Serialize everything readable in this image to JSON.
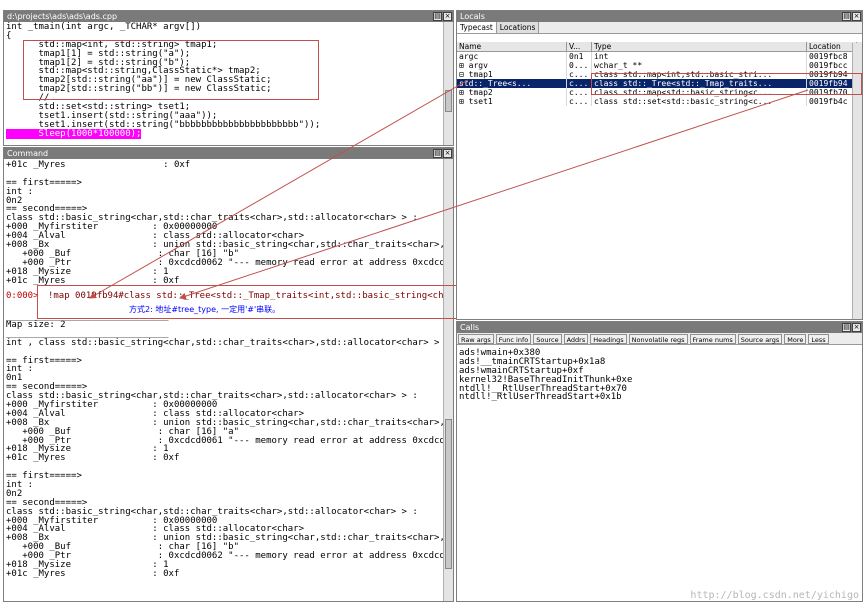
{
  "source_window": {
    "title": "d:\\projects\\ads\\ads\\ads.cpp",
    "lines": [
      "int _tmain(int argc, _TCHAR* argv[])",
      "{",
      "      std::map<int, std::string> tmap1;",
      "      tmap1[1] = std::string(\"a\");",
      "      tmap1[2] = std::string(\"b\");",
      "      std::map<std::string,ClassStatic*> tmap2;",
      "      tmap2[std::string(\"aa\")] = new ClassStatic;",
      "      tmap2[std::string(\"bb\")] = new ClassStatic;",
      "      //",
      "      std::set<std::string> tset1;",
      "      tset1.insert(std::string(\"aaa\"));",
      "      tset1.insert(std::string(\"bbbbbbbbbbbbbbbbbbbbbb\"));",
      "      Sleep(1000*100000);"
    ]
  },
  "command_window": {
    "title": "Command",
    "top_lines": [
      "+01c _Myres                  : 0xf",
      "",
      "== first=====>",
      "int :",
      "0n2",
      "== second=====>",
      "class std::basic_string<char,std::char_traits<char>,std::allocator<char> > :",
      "+000 _Myfirstiter          : 0x00000000",
      "+004 _Alval                : class std::allocator<char>",
      "+008 _Bx                   : union std::basic_string<char,std::char_traits<char>,std::all",
      "   +000 _Buf                : char [16] \"b\"",
      "   +000 _Ptr                : 0xcdcd0062 \"--- memory read error at address 0xcdcd0062 -",
      "+018 _Mysize               : 1",
      "+01c _Myres                : 0xf"
    ],
    "prompt_prefix": "0:000>",
    "command_text": "!map 0019fb94#class std::_Tree<std::_Tmap_traits<int,std::basic_string<ch",
    "annotation_note": "方式2: 地址#tree_type, 一定用'#'串联。",
    "separator": "______________________________",
    "bottom_lines": [
      "Map size: 2",
      "______________________________",
      "int , class std::basic_string<char,std::char_traits<char>,std::allocator<char> >",
      "",
      "== first=====>",
      "int :",
      "0n1",
      "== second=====>",
      "class std::basic_string<char,std::char_traits<char>,std::allocator<char> > :",
      "+000 _Myfirstiter          : 0x00000000",
      "+004 _Alval                : class std::allocator<char>",
      "+008 _Bx                   : union std::basic_string<char,std::char_traits<char>,std::all",
      "   +000 _Buf                : char [16] \"a\"",
      "   +000 _Ptr                : 0xcdcd0061 \"--- memory read error at address 0xcdcd0061 -",
      "+018 _Mysize               : 1",
      "+01c _Myres                : 0xf",
      "",
      "== first=====>",
      "int :",
      "0n2",
      "== second=====>",
      "class std::basic_string<char,std::char_traits<char>,std::allocator<char> > :",
      "+000 _Myfirstiter          : 0x00000000",
      "+004 _Alval                : class std::allocator<char>",
      "+008 _Bx                   : union std::basic_string<char,std::char_traits<char>,std::all",
      "   +000 _Buf                : char [16] \"b\"",
      "   +000 _Ptr                : 0xcdcd0062 \"--- memory read error at address 0xcdcd0062 -",
      "+018 _Mysize               : 1",
      "+01c _Myres                : 0xf"
    ]
  },
  "locals_window": {
    "title": "Locals",
    "tabs": [
      "Typecast",
      "Locations"
    ],
    "columns": [
      "Name",
      "V...",
      "Type",
      "Location"
    ],
    "rows": [
      {
        "name": "  argc",
        "value": "0n1",
        "type": "int",
        "location": "0019fbc8"
      },
      {
        "name": "⊞ argv",
        "value": "0...",
        "type": "wchar_t **",
        "location": "0019fbcc"
      },
      {
        "name": "⊟ tmap1",
        "value": "c...",
        "type": "class std::map<int,std::basic_stri...",
        "location": "0019fb94"
      },
      {
        "name": "    std::_Tree<s...",
        "value": "c...",
        "type": "class std::_Tree<std::_Tmap_traits...",
        "location": "0019fb94"
      },
      {
        "name": "⊞ tmap2",
        "value": "c...",
        "type": "class std::map<std::basic_string<c...",
        "location": "0019fb70"
      },
      {
        "name": "⊞ tset1",
        "value": "c...",
        "type": "class std::set<std::basic_string<c...",
        "location": "0019fb4c"
      }
    ]
  },
  "calls_window": {
    "title": "Calls",
    "buttons": [
      "Raw args",
      "Func info",
      "Source",
      "Addrs",
      "Headings",
      "Nonvolatile regs",
      "Frame nums",
      "Source args",
      "More",
      "Less"
    ],
    "frames": [
      "ads!wmain+0x380",
      "ads!__tmainCRTStartup+0x1a8",
      "ads!wmainCRTStartup+0xf",
      "kernel32!BaseThreadInitThunk+0xe",
      "ntdll!__RtlUserThreadStart+0x70",
      "ntdll!_RtlUserThreadStart+0x1b"
    ]
  },
  "watermark": "http://blog.csdn.net/yichigo",
  "colors": {
    "annotation": "#c0504d",
    "highlight": "#ff00ff",
    "selected_row": "#0a246a",
    "note_text": "#0000ff"
  }
}
